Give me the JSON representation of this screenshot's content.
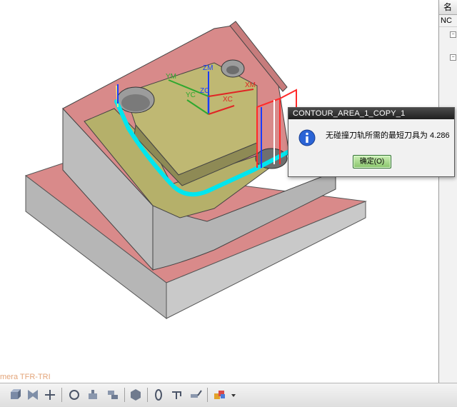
{
  "dialog": {
    "title": "CONTOUR_AREA_1_COPY_1",
    "message": "无碰撞刀轨所需的最短刀具为 4.286",
    "ok_label": "确定(O)"
  },
  "viewport": {
    "camera_label": "mera TFR-TRI",
    "axes": {
      "ym": "YM",
      "yc": "YC",
      "zm": "ZM",
      "zc": "ZC",
      "xc": "XC",
      "xm": "XM"
    }
  },
  "side_panel": {
    "header": "名",
    "row": "NC"
  },
  "toolbar": {
    "icons": [
      "view-cube-icon",
      "shade-icon",
      "fit-icon",
      "rotate-icon",
      "pan-icon",
      "layer-icon",
      "render-icon",
      "hole-icon",
      "link-icon",
      "drill-icon",
      "align-icon",
      "color-icon"
    ]
  },
  "colors": {
    "part_top": "#d58585",
    "part_side": "#b9b9b9",
    "floor": "#b8b05a",
    "toolpath": "#00e5ee",
    "dialog_title": "#2a2a2a",
    "ok_button": "#9fd47f"
  }
}
